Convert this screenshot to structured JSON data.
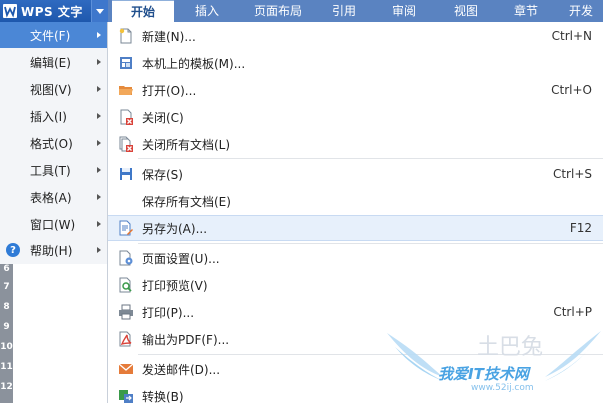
{
  "app": {
    "title": "WPS 文字"
  },
  "tabs": [
    {
      "label": "开始",
      "active": true
    },
    {
      "label": "插入"
    },
    {
      "label": "页面布局"
    },
    {
      "label": "引用"
    },
    {
      "label": "审阅"
    },
    {
      "label": "视图"
    },
    {
      "label": "章节"
    },
    {
      "label": "开发"
    }
  ],
  "left_menu": [
    {
      "label": "文件(F)",
      "active": true
    },
    {
      "label": "编辑(E)"
    },
    {
      "label": "视图(V)"
    },
    {
      "label": "插入(I)"
    },
    {
      "label": "格式(O)"
    },
    {
      "label": "工具(T)"
    },
    {
      "label": "表格(A)"
    },
    {
      "label": "窗口(W)"
    },
    {
      "label": "帮助(H)",
      "icon": "help-icon"
    }
  ],
  "file_menu": [
    {
      "label": "新建(N)...",
      "shortcut": "Ctrl+N",
      "icon": "new-document-icon"
    },
    {
      "label": "本机上的模板(M)...",
      "shortcut": "",
      "icon": "template-icon"
    },
    {
      "label": "打开(O)...",
      "shortcut": "Ctrl+O",
      "icon": "open-folder-icon"
    },
    {
      "label": "关闭(C)",
      "shortcut": "",
      "icon": "close-document-icon"
    },
    {
      "label": "关闭所有文档(L)",
      "shortcut": "",
      "icon": "close-all-icon"
    },
    {
      "label": "保存(S)",
      "shortcut": "Ctrl+S",
      "icon": "save-icon"
    },
    {
      "label": "保存所有文档(E)",
      "shortcut": "",
      "icon": ""
    },
    {
      "label": "另存为(A)...",
      "shortcut": "F12",
      "icon": "save-as-icon",
      "highlighted": true
    },
    {
      "label": "页面设置(U)...",
      "shortcut": "",
      "icon": "page-setup-icon"
    },
    {
      "label": "打印预览(V)",
      "shortcut": "",
      "icon": "print-preview-icon"
    },
    {
      "label": "打印(P)...",
      "shortcut": "Ctrl+P",
      "icon": "printer-icon"
    },
    {
      "label": "输出为PDF(F)...",
      "shortcut": "",
      "icon": "pdf-icon"
    },
    {
      "label": "发送邮件(D)...",
      "shortcut": "",
      "icon": "mail-icon"
    },
    {
      "label": "转换(B)",
      "shortcut": "",
      "icon": "convert-icon"
    }
  ],
  "ruler": {
    "numbers": [
      "6",
      "7",
      "8",
      "9",
      "10",
      "11",
      "12"
    ]
  },
  "watermark": {
    "text": "我爱IT技术网",
    "url": "www.52ij.com",
    "top": "土巴兔"
  },
  "colors": {
    "topbar": "#5a83c1",
    "app_button": "#1e58ad",
    "menu_active": "#4b87d6",
    "item_highlight": "#e7f0fb"
  }
}
